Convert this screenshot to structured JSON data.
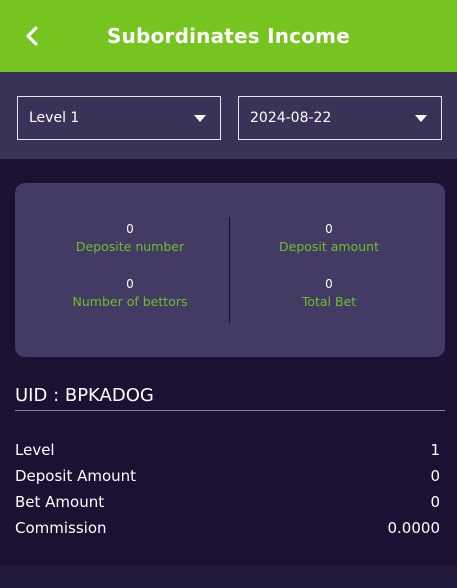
{
  "header": {
    "title": "Subordinates Income",
    "back_icon": "chevron-left-icon"
  },
  "filters": {
    "level": "Level 1",
    "date": "2024-08-22",
    "caret_icon": "caret-down-icon"
  },
  "summary": {
    "deposit_number": {
      "value": "0",
      "label": "Deposite number"
    },
    "deposit_amount": {
      "value": "0",
      "label": "Deposit amount"
    },
    "number_of_bettors": {
      "value": "0",
      "label": "Number of bettors"
    },
    "total_bet": {
      "value": "0",
      "label": "Total Bet"
    }
  },
  "uid": {
    "title": "UID : BPKADOG"
  },
  "details": [
    {
      "label": "Level",
      "value": "1"
    },
    {
      "label": "Deposit Amount",
      "value": "0"
    },
    {
      "label": "Bet Amount",
      "value": "0"
    },
    {
      "label": "Commission",
      "value": "0.0000"
    }
  ],
  "colors": {
    "header_green": "#76c41f",
    "label_green": "#6fbf2a",
    "background": "#1b1233",
    "card": "#433b63"
  }
}
